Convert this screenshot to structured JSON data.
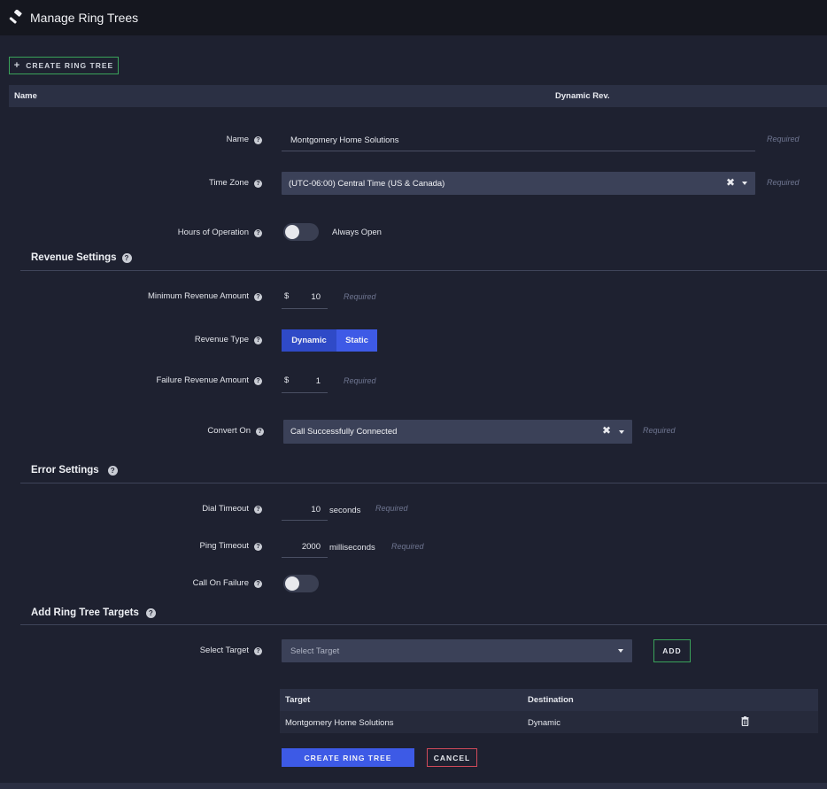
{
  "header": {
    "title": "Manage Ring Trees",
    "icon": "gavel-icon"
  },
  "toolbar": {
    "create_label": "CREATE RING TREE"
  },
  "table": {
    "columns": [
      "Name",
      "Dynamic Rev."
    ]
  },
  "form": {
    "name": {
      "label": "Name",
      "value": "Montgomery Home Solutions",
      "required": "Required"
    },
    "time_zone": {
      "label": "Time Zone",
      "value": "(UTC-06:00) Central Time (US & Canada)",
      "required": "Required"
    },
    "hours": {
      "label": "Hours of Operation",
      "value": "Always Open",
      "enabled": false
    }
  },
  "revenue": {
    "title": "Revenue Settings",
    "min_amount": {
      "label": "Minimum Revenue Amount",
      "currency": "$",
      "value": "10",
      "required": "Required"
    },
    "type": {
      "label": "Revenue Type",
      "options": [
        "Dynamic",
        "Static"
      ],
      "selected": "Static"
    },
    "failure_amount": {
      "label": "Failure Revenue Amount",
      "currency": "$",
      "value": "1",
      "required": "Required"
    },
    "convert_on": {
      "label": "Convert On",
      "value": "Call Successfully Connected",
      "required": "Required"
    }
  },
  "errors": {
    "title": "Error Settings",
    "dial_timeout": {
      "label": "Dial Timeout",
      "value": "10",
      "unit": "seconds",
      "required": "Required"
    },
    "ping_timeout": {
      "label": "Ping Timeout",
      "value": "2000",
      "unit": "milliseconds",
      "required": "Required"
    },
    "call_on_failure": {
      "label": "Call On Failure",
      "enabled": false
    }
  },
  "targets": {
    "title": "Add Ring Tree Targets",
    "select_label": "Select Target",
    "select_placeholder": "Select Target",
    "add_label": "ADD",
    "columns": [
      "Target",
      "Destination"
    ],
    "rows": [
      {
        "target": "Montgomery Home Solutions",
        "destination": "Dynamic"
      }
    ]
  },
  "actions": {
    "create_label": "CREATE RING TREE",
    "cancel_label": "CANCEL"
  },
  "colors": {
    "accent": "#3d5ae6",
    "success": "#3aa35a",
    "danger": "#d04a5a",
    "background": "#1e2130"
  }
}
